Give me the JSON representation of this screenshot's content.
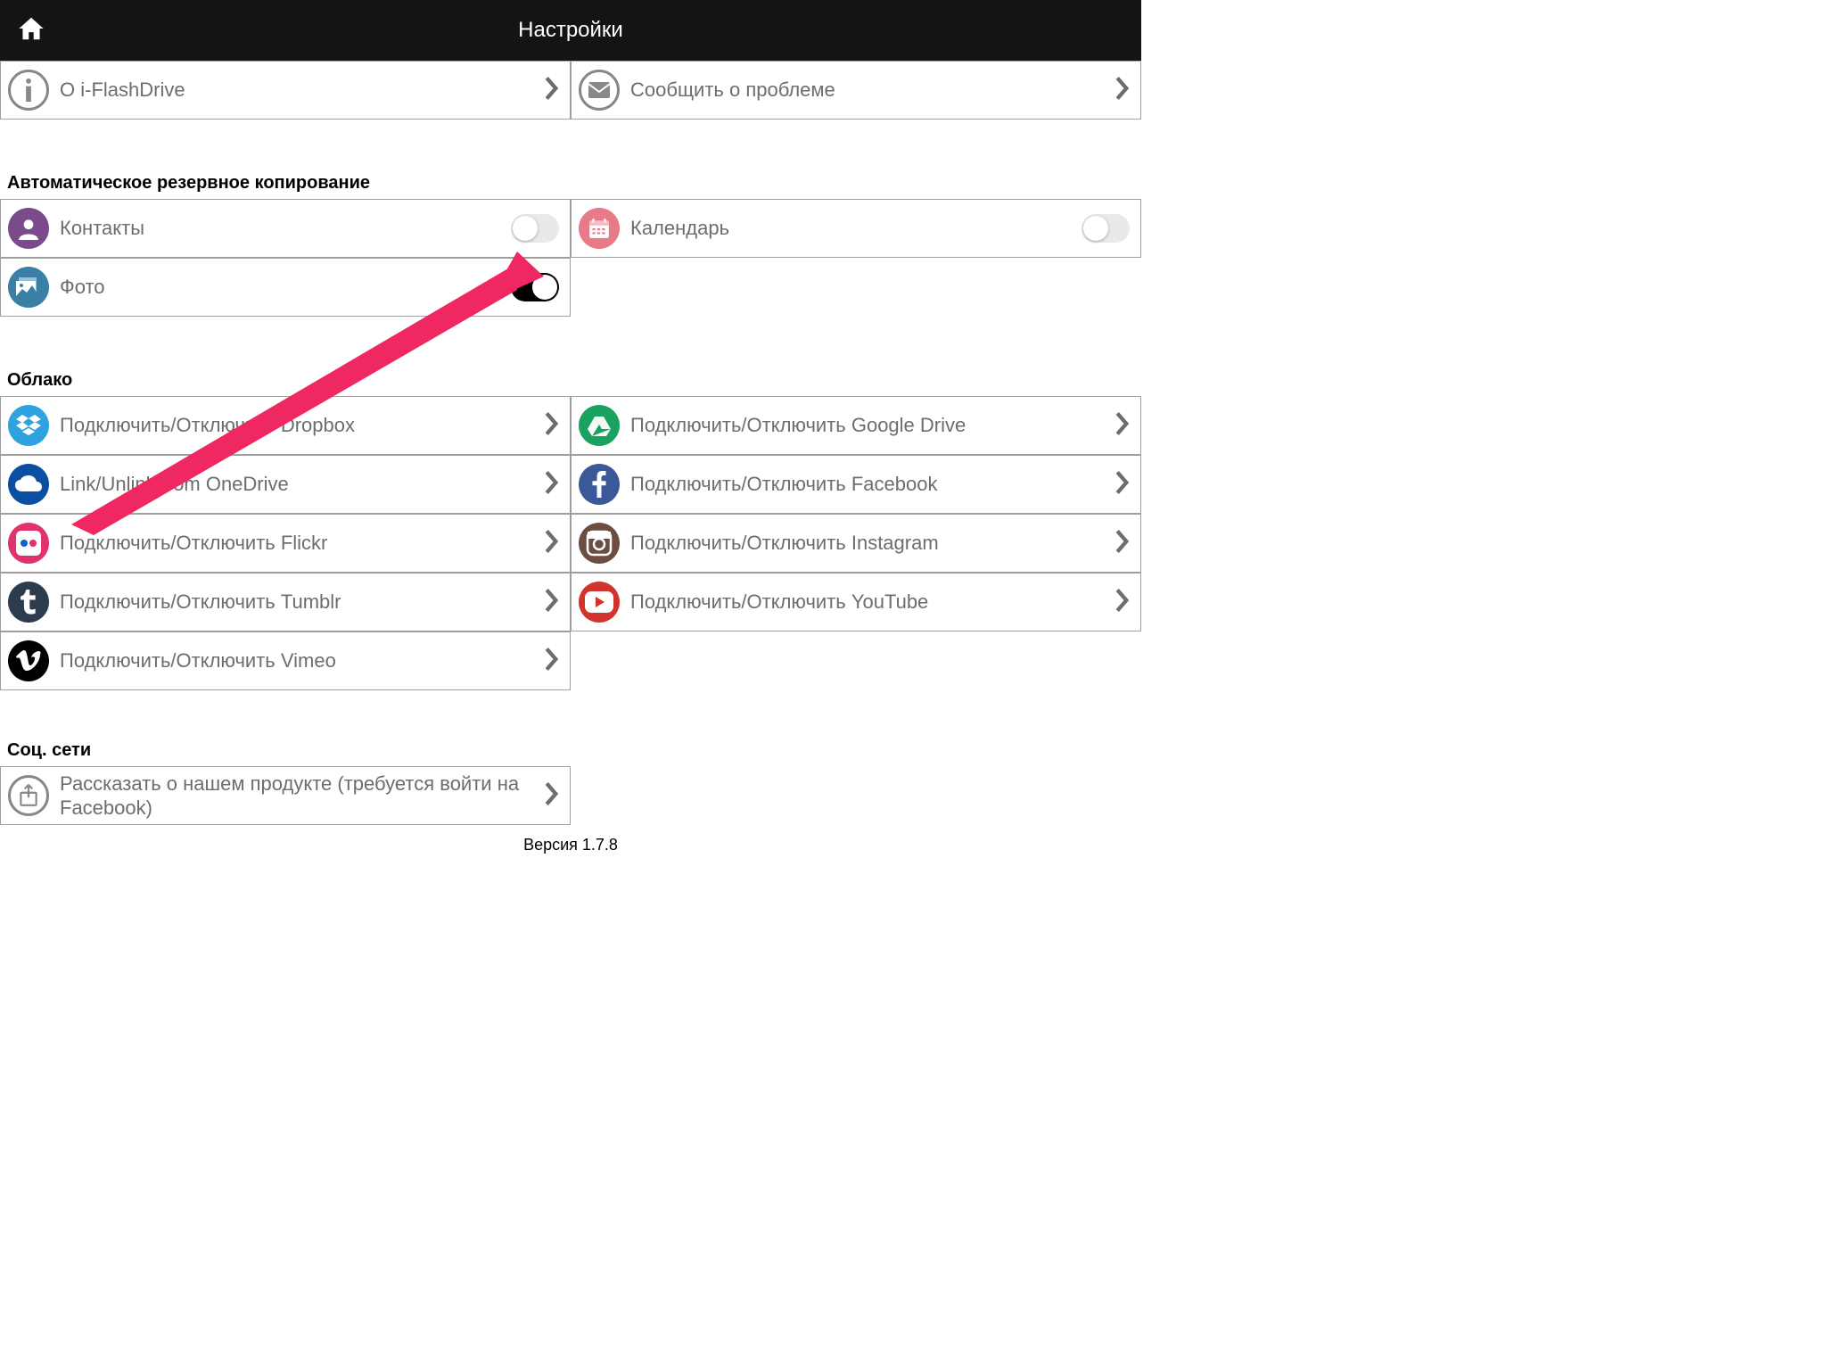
{
  "header": {
    "title": "Настройки"
  },
  "top": {
    "about": "О i-FlashDrive",
    "report": "Сообщить о проблеме"
  },
  "backup": {
    "title": "Автоматическое резервное копирование",
    "contacts": "Контакты",
    "calendar": "Календарь",
    "photo": "Фото"
  },
  "cloud": {
    "title": "Облако",
    "dropbox": "Подключить/Отключить Dropbox",
    "gdrive": "Подключить/Отключить Google Drive",
    "onedrive": "Link/Unlink from OneDrive",
    "facebook": "Подключить/Отключить Facebook",
    "flickr": "Подключить/Отключить  Flickr",
    "instagram": "Подключить/Отключить Instagram",
    "tumblr": "Подключить/Отключить Tumblr",
    "youtube": "Подключить/Отключить YouTube",
    "vimeo": "Подключить/Отключить Vimeo"
  },
  "social": {
    "title": "Соц. сети",
    "share": "Рассказать о нашем продукте (требуется войти на Facebook)"
  },
  "version": "Версия 1.7.8",
  "toggles": {
    "contacts": false,
    "calendar": false,
    "photo": true
  },
  "colors": {
    "contacts": "#7a4a8a",
    "calendar": "#e87b8a",
    "photo": "#3a7fa6",
    "dropbox": "#2fa3e0",
    "gdrive": "#1ba261",
    "onedrive": "#0a4fa1",
    "facebook": "#3b5998",
    "flickr": "#e0336b",
    "instagram": "#6b4d42",
    "tumblr": "#2d3c4d",
    "youtube": "#d0342c",
    "vimeo": "#000000",
    "info": "#888888",
    "mail": "#888888",
    "share": "#888888"
  }
}
